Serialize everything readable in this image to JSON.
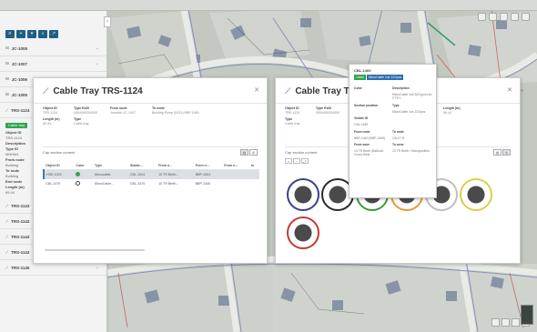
{
  "left_panel": {
    "header": "",
    "items": [
      {
        "label": "JC-1008"
      },
      {
        "label": "JC-1007"
      },
      {
        "label": "JC-1006"
      },
      {
        "label": "JC-1005"
      }
    ],
    "expanded_item": {
      "label": "TRS-1124",
      "tag": "Cable tray",
      "fields": [
        {
          "label": "Object ID",
          "value": "TRS-1124"
        },
        {
          "label": "Description",
          "value": ""
        },
        {
          "label": "Type ID",
          "value": "MHHM1"
        },
        {
          "label": "From node",
          "value": "Building"
        },
        {
          "label": "To node",
          "value": "Building"
        },
        {
          "label": "End node",
          "value": ""
        },
        {
          "label": "Length (m)",
          "value": "69.44"
        }
      ]
    },
    "tray_items": [
      {
        "label": "TRS-1143"
      },
      {
        "label": "TRS-1143"
      },
      {
        "label": "TRS-1143"
      },
      {
        "label": "TRS-1143"
      },
      {
        "label": "TRS-1145"
      }
    ]
  },
  "dialog_left": {
    "title": "Cable Tray TRS-1124",
    "properties": [
      {
        "key": "Object ID",
        "value": "TRS-1124"
      },
      {
        "key": "Type ExID",
        "value": "0004459204000"
      },
      {
        "key": "From node",
        "value": "Junction JC-1007"
      },
      {
        "key": "To node",
        "value": "Building Pump (8131) BBP 1960"
      },
      {
        "key": "Length (m)",
        "value": "69.44"
      },
      {
        "key": "Type",
        "value": "Cable tray"
      }
    ],
    "section_label": "Cap section content",
    "table": {
      "headers": [
        "Object ID",
        "Color",
        "Type",
        "Stable...",
        "From n...",
        "From n...",
        "From n...",
        "In"
      ],
      "rows": [
        {
          "id": "HSE-1024",
          "color": "#2ea44f",
          "type": "Microcable",
          "stable": "CBL-1024",
          "f1": "10 TR Berth...",
          "f2": "BBP-1004",
          "f3": "",
          "sel": true
        },
        {
          "id": "CBL-1470",
          "color": "#ffffff",
          "type": "MicroCable...",
          "stable": "CBL-1470",
          "f1": "10 TR Berth...",
          "f2": "BBP-1440",
          "f3": "",
          "sel": false
        }
      ]
    }
  },
  "dialog_right": {
    "title": "Cable Tray TRS-1124",
    "properties": [
      {
        "key": "Object ID",
        "value": "TRS-1124"
      },
      {
        "key": "Type ExID",
        "value": "0004459204000"
      },
      {
        "key": "Length (m)",
        "value": "69.44"
      },
      {
        "key": "Type",
        "value": "Cable tray"
      }
    ],
    "section_label": "Cap section content",
    "cross_section": [
      {
        "ring": "#3d3d8a"
      },
      {
        "ring": "#2a2a2a"
      },
      {
        "ring": "#3c9a3c"
      },
      {
        "ring": "#e89a3a"
      },
      {
        "ring": "#bfbfbf"
      },
      {
        "ring": "#d9cf4a"
      },
      {
        "ring": "#c23a34"
      }
    ]
  },
  "tooltip": {
    "title": "CBL-1469",
    "tag1": "Cable",
    "tag2": "MicroCable 1x4 12/2pcs",
    "fields": [
      {
        "key": "Color",
        "value": ""
      },
      {
        "key": "Description",
        "value": "MicroCable 1x4 B2C(pcs) for FTTH"
      },
      {
        "key": "Section position",
        "value": ""
      },
      {
        "key": "Type",
        "value": "MicroCable 1x4 12/2pcs"
      },
      {
        "key": "Visible ID",
        "value": "CBL-1469"
      },
      {
        "key": "",
        "value": ""
      },
      {
        "key": "From node",
        "value": "BBP-1460 (BBP-1469)"
      },
      {
        "key": "To node",
        "value": "CB-1T-R"
      },
      {
        "key": "From zone",
        "value": "10 TR Berth (Balticon Zone) West"
      },
      {
        "key": "To zone",
        "value": "10 TR Berth / Microposition"
      }
    ]
  }
}
